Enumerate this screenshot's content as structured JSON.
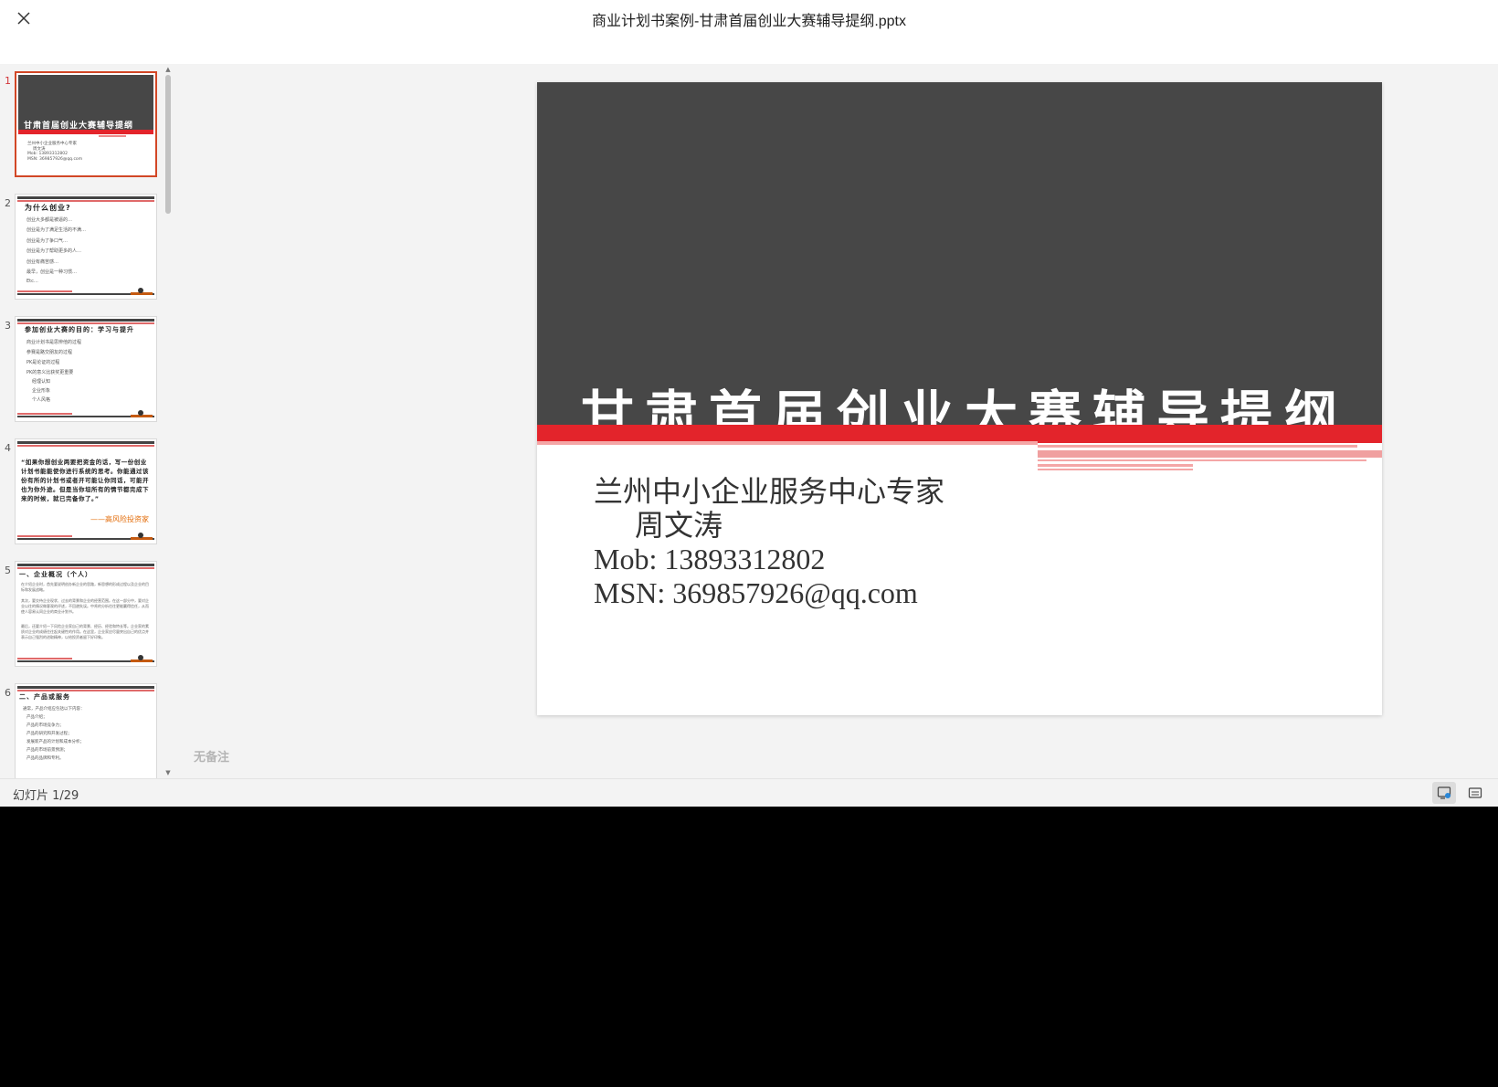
{
  "header": {
    "title": "商业计划书案例-甘肃首届创业大赛辅导提纲.pptx"
  },
  "thumbnails": [
    {
      "number": "1",
      "title": "甘肃首届创业大赛辅导提纲",
      "lines": [
        "兰州中小企业服务中心专家",
        "周文涛",
        "Mob: 13893312802",
        "MSN: 369857926@qq.com"
      ]
    },
    {
      "number": "2",
      "title": "为什么创业?",
      "lines": [
        "创业大多都是被逼的…",
        "创业是为了满足生活的不满…",
        "创业是为了争口气…",
        "创业是为了帮助更多的人…",
        "创业有痛苦感…",
        "最早，创业是一种习惯…",
        "Etc…"
      ]
    },
    {
      "number": "3",
      "title": "参加创业大赛的目的：学习与提升",
      "lines": [
        "商业计划书是思辨他的过程",
        "参赛是路交朋友的过程",
        "PK是论证的过程",
        "PK的意义比获奖更重要",
        "经理认知",
        "企业形象",
        "个人风格"
      ]
    },
    {
      "number": "4",
      "quote": "“如果你想创业两要把资金的话，写一份创业计划书能能使你进行系统的思考。你能通过该份有所的计划书或者开可能让你同话，可能开也为你外途。但是当你坦所有的情节都完成下来的时候，就已完备你了。”",
      "signature": "——高风险投资家"
    },
    {
      "number": "5",
      "title": "一、企业概况（个人）",
      "paras": [
        "在介绍企业时，首先要说明创办新企业的思路，新思想的形成过程以及企业的目标和发展战略。",
        "其次，要交待企业现状、过去的背景和企业的经营范围。在这一部分中，要对企业以往的情况做客观的评述，不回避失误。中肯的分析往往更能赢得信任，从而使人容易认同企业的商业计划书。",
        "最后，还要介绍一下风险企业家自己的背景、经历、经验和特长等。企业家的素质对企业的成绩往往起关键性的作用。在这里，企业家应尽量突出自己的优点并表示自己强烈的进取精神，以给投资者留下好印象。"
      ]
    },
    {
      "number": "6",
      "title": "二、产品或服务",
      "lines": [
        "通常，产品介绍应包括以下内容：",
        "产品介绍；",
        "产品的市场竞争力；",
        "产品的研究和开发过程；",
        "发展新产品的计划和成本分析；",
        "产品的市场前景预测；",
        "产品的品牌和专利。"
      ]
    }
  ],
  "slide": {
    "title": "甘肃首届创业大赛辅导提纲",
    "lines": [
      {
        "text": "兰州中小企业服务中心专家",
        "indent": false
      },
      {
        "text": "周文涛",
        "indent": true
      },
      {
        "text": "Mob: 13893312802",
        "indent": false
      },
      {
        "text": "MSN: 369857926@qq.com",
        "indent": false
      }
    ]
  },
  "notes": {
    "placeholder": "无备注"
  },
  "status": {
    "slide_counter": "幻灯片 1/29"
  },
  "colors": {
    "accent": "#d24726",
    "slide_dark": "#474747",
    "slide_red": "#e3242b"
  }
}
